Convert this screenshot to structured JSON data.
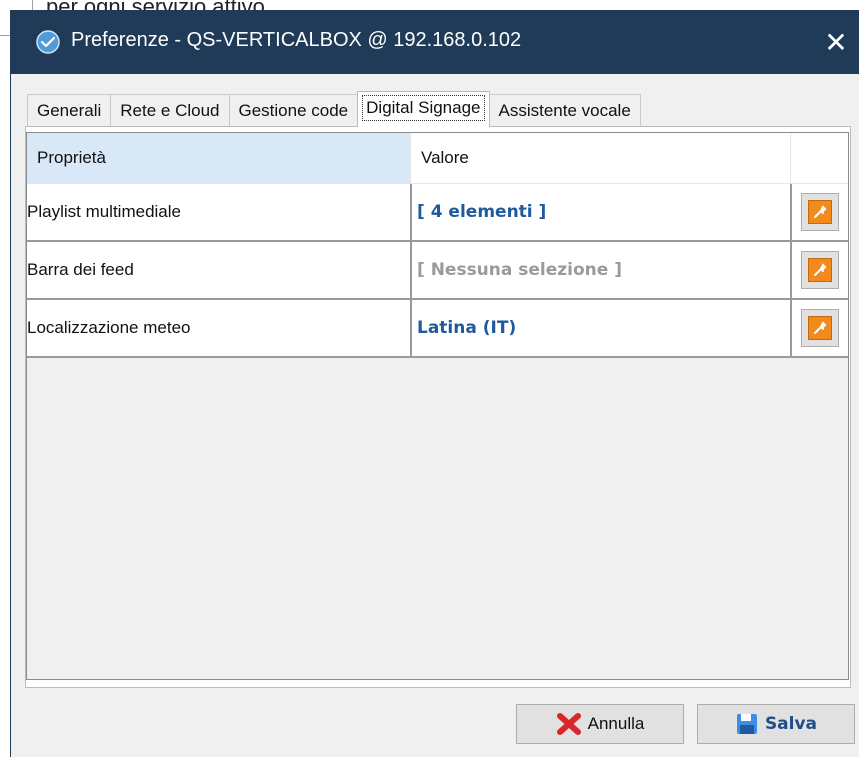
{
  "background": {
    "text": "per ogni servizio attivo"
  },
  "window": {
    "title": "Preferenze - QS-VERTICALBOX @ 192.168.0.102",
    "close_label": "✕"
  },
  "tabs": [
    {
      "label": "Generali"
    },
    {
      "label": "Rete e Cloud"
    },
    {
      "label": "Gestione code"
    },
    {
      "label": "Digital Signage",
      "active": true
    },
    {
      "label": "Assistente vocale"
    }
  ],
  "grid": {
    "header": {
      "property": "Proprietà",
      "value": "Valore"
    },
    "rows": [
      {
        "property": "Playlist multimediale",
        "value": "[ 4 elementi ]",
        "value_color": "#1f5a9e"
      },
      {
        "property": "Barra dei feed",
        "value": "[ Nessuna selezione ]",
        "value_color": "#9a9a9a"
      },
      {
        "property": "Localizzazione meteo",
        "value": "Latina (IT)",
        "value_color": "#1f5a9e"
      }
    ]
  },
  "buttons": {
    "cancel": "Annulla",
    "save": "Salva"
  },
  "colors": {
    "titlebar": "#1f3b57",
    "accent_wrench": "#f28a1c",
    "cancel_icon": "#d9262b",
    "save_icon": "#3a8ee6"
  }
}
